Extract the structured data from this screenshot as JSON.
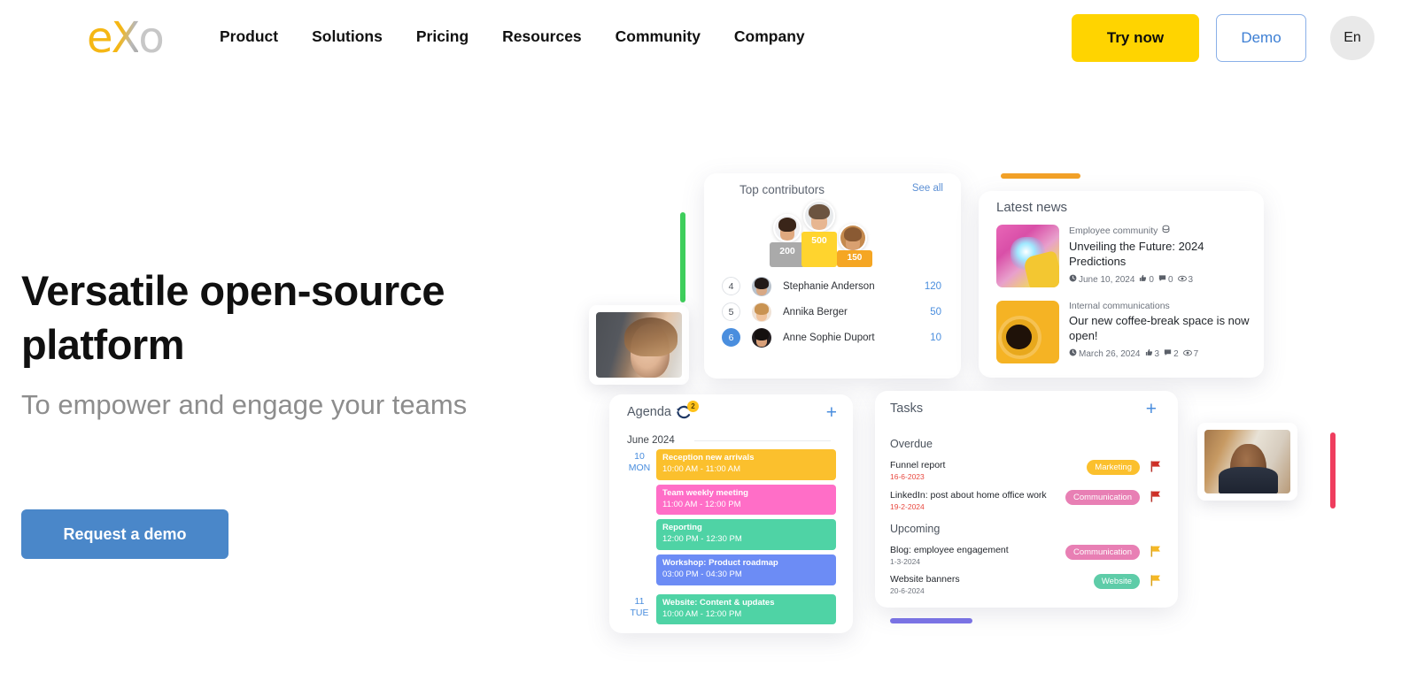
{
  "header": {
    "logo": {
      "e": "e",
      "x": "X",
      "o": "o",
      "alt": "eXo"
    },
    "nav": [
      {
        "label": "Product"
      },
      {
        "label": "Solutions"
      },
      {
        "label": "Pricing"
      },
      {
        "label": "Resources"
      },
      {
        "label": "Community"
      },
      {
        "label": "Company"
      }
    ],
    "try_label": "Try now",
    "demo_label": "Demo",
    "lang_label": "En"
  },
  "hero": {
    "title": "Versatile open-source platform",
    "subtitle": "To empower and engage your teams",
    "cta_label": "Request a demo"
  },
  "colors": {
    "brand_yellow": "#FFD400",
    "brand_orange": "#f5b715",
    "accent_blue": "#4a87c9",
    "link_blue": "#4a8ede",
    "decor_green": "#3fcf5c",
    "decor_orange": "#f2a128",
    "decor_purple": "#7b74e8",
    "decor_red": "#ef3d5e"
  },
  "contributors": {
    "title": "Top contributors",
    "see_all": "See all",
    "podium": [
      {
        "rank": 2,
        "score": "200",
        "color": "#aaaaaa"
      },
      {
        "rank": 1,
        "score": "500",
        "color": "#FFD42E"
      },
      {
        "rank": 3,
        "score": "150",
        "color": "#F5A623"
      }
    ],
    "list": [
      {
        "rank": "4",
        "name": "Stephanie Anderson",
        "score": "120",
        "active": false
      },
      {
        "rank": "5",
        "name": "Annika Berger",
        "score": "50",
        "active": false
      },
      {
        "rank": "6",
        "name": "Anne Sophie Duport",
        "score": "10",
        "active": true
      }
    ]
  },
  "news": {
    "title": "Latest news",
    "items": [
      {
        "category": "Employee community",
        "title": "Unveiling the Future: 2024 Predictions",
        "date": "June 10, 2024",
        "likes": "0",
        "comments": "0",
        "views": "3"
      },
      {
        "category": "Internal communications",
        "title": "Our new coffee-break space is now open!",
        "date": "March 26, 2024",
        "likes": "3",
        "comments": "2",
        "views": "7"
      }
    ]
  },
  "agenda": {
    "title": "Agenda",
    "badge_count": "2",
    "add_label": "+",
    "month": "June 2024",
    "days": [
      {
        "num": "10",
        "name": "MON",
        "events": [
          {
            "title": "Reception new arrivals",
            "time": "10:00 AM  -  11:00 AM",
            "color": "yellow"
          },
          {
            "title": "Team weekly meeting",
            "time": "11:00 AM  -  12:00 PM",
            "color": "pink"
          },
          {
            "title": "Reporting",
            "time": "12:00 PM  -  12:30 PM",
            "color": "teal"
          },
          {
            "title": "Workshop: Product roadmap",
            "time": "03:00 PM  -  04:30 PM",
            "color": "blue"
          }
        ]
      },
      {
        "num": "11",
        "name": "TUE",
        "events": [
          {
            "title": "Website: Content & updates",
            "time": "10:00 AM  -  12:00 PM",
            "color": "teal"
          }
        ]
      }
    ]
  },
  "tasks": {
    "title": "Tasks",
    "add_label": "+",
    "sections": [
      {
        "label": "Overdue"
      },
      {
        "label": "Upcoming"
      }
    ],
    "items": [
      {
        "name": "Funnel report",
        "date": "16-6-2023",
        "tag": "Marketing",
        "tag_color": "#FBC02D",
        "flag": "red",
        "status": "overdue"
      },
      {
        "name": "LinkedIn: post about home office work",
        "date": "19-2-2024",
        "tag": "Communication",
        "tag_color": "#E87FB4",
        "flag": "red",
        "status": "overdue"
      },
      {
        "name": "Blog: employee engagement",
        "date": "1-3-2024",
        "tag": "Communication",
        "tag_color": "#E87FB4",
        "flag": "yellow",
        "status": "upcoming"
      },
      {
        "name": "Website banners",
        "date": "20-6-2024",
        "tag": "Website",
        "tag_color": "#5ECCA8",
        "flag": "yellow",
        "status": "upcoming"
      }
    ]
  }
}
